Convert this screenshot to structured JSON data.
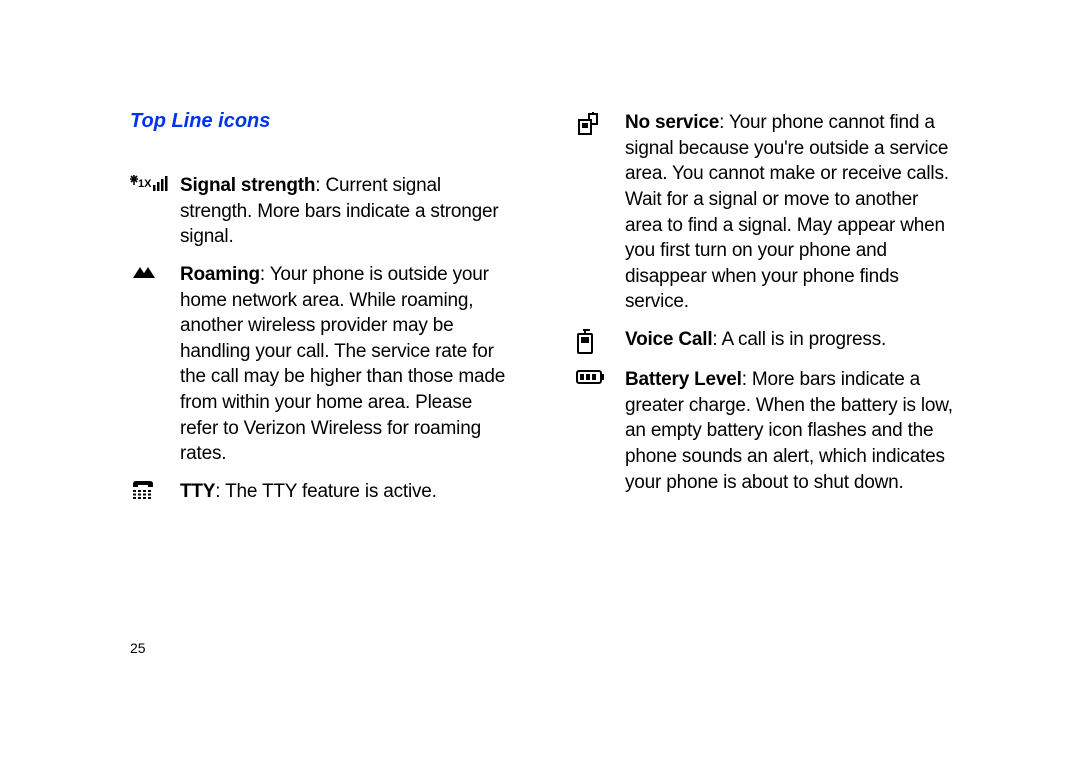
{
  "heading": "Top Line icons",
  "pageNumber": "25",
  "left": [
    {
      "icon": "signal-strength-icon",
      "term": "Signal strength",
      "text": ": Current signal strength. More bars indicate a stronger signal."
    },
    {
      "icon": "roaming-icon",
      "term": "Roaming",
      "text": ": Your phone is outside your home network area. While roaming, another wireless provider may be handling your call. The service rate for the call may be higher than those made from within your home area. Please refer to Verizon Wireless for roaming rates."
    },
    {
      "icon": "tty-icon",
      "term": "TTY",
      "text": ": The TTY feature is active."
    }
  ],
  "right": [
    {
      "icon": "no-service-icon",
      "term": "No service",
      "text": ": Your phone cannot find a signal because you're outside a service area. You cannot make or receive calls. Wait for a signal or move to another area to find a signal. May appear when you first turn on your phone and disappear when your phone finds service."
    },
    {
      "icon": "voice-call-icon",
      "term": "Voice Call",
      "text": ": A call is in progress."
    },
    {
      "icon": "battery-level-icon",
      "term": "Battery Level",
      "text": ": More bars indicate a greater charge. When the battery is low, an empty battery icon flashes and the phone sounds an alert, which indicates your phone is about to shut down."
    }
  ]
}
